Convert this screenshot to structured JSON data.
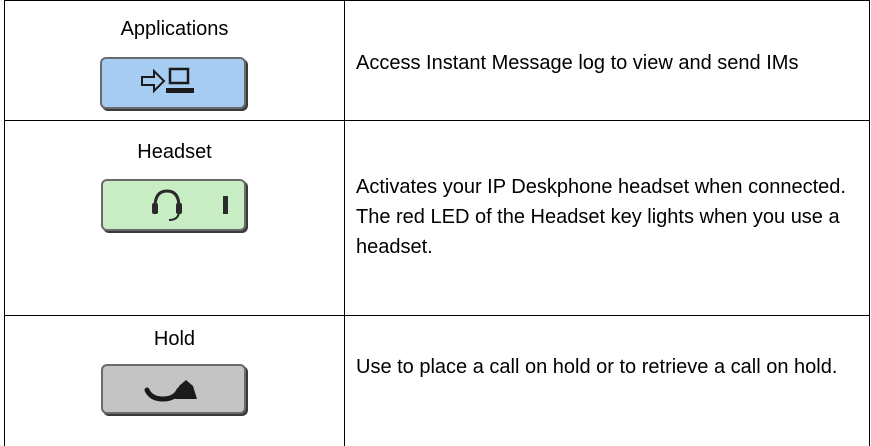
{
  "rows": [
    {
      "key_label": "Applications",
      "icon": "arrow-to-monitor-icon",
      "key_color": "#a6ccf2",
      "description": "Access Instant Message log to view and send IMs"
    },
    {
      "key_label": "Headset",
      "icon": "headset-icon",
      "key_color": "#c8ecc4",
      "description": "Activates your IP Deskphone headset when connected. The red LED of the Headset key lights when you use a headset."
    },
    {
      "key_label": "Hold",
      "icon": "handset-hold-icon",
      "key_color": "#c4c4c4",
      "description": "Use to place a call on hold or to retrieve a call on hold."
    }
  ]
}
